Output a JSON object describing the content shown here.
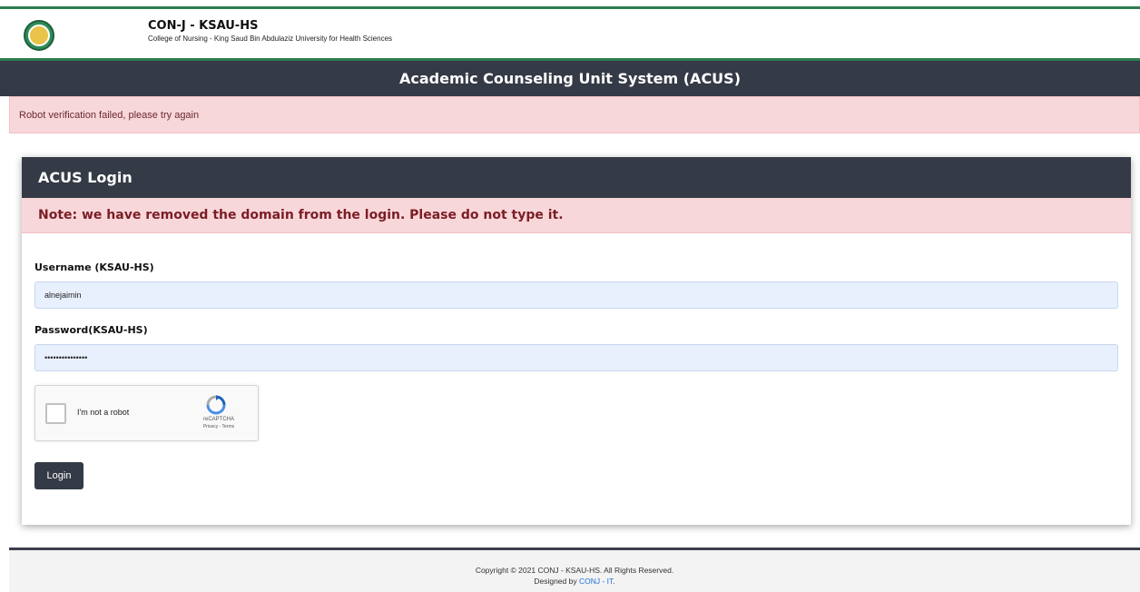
{
  "header": {
    "org_title": "CON-J - KSAU-HS",
    "org_subtitle": "College of Nursing - King Saud Bin Abdulaziz University for Health Sciences",
    "app_title": "Academic Counseling Unit System (ACUS)"
  },
  "alert": {
    "message": "Robot verification failed, please try again"
  },
  "login_card": {
    "title": "ACUS Login",
    "note": "Note: we have removed the domain from the login. Please do not type it.",
    "username_label": "Username (KSAU-HS)",
    "username_value": "alnejaimin",
    "password_label": "Password(KSAU-HS)",
    "password_value": "•••••••••••••••",
    "recaptcha": {
      "label": "I'm not a robot",
      "brand": "reCAPTCHA",
      "terms": "Privacy - Terms"
    },
    "login_button": "Login"
  },
  "footer": {
    "copyright": "Copyright © 2021 CONJ - KSAU-HS. All Rights Reserved.",
    "designed_prefix": "Designed by ",
    "designed_link": "CONJ - IT",
    "designed_suffix": "."
  },
  "colors": {
    "brand_green": "#2e7d4f",
    "dark_bar": "#343a46",
    "alert_bg": "#f8d7da"
  }
}
